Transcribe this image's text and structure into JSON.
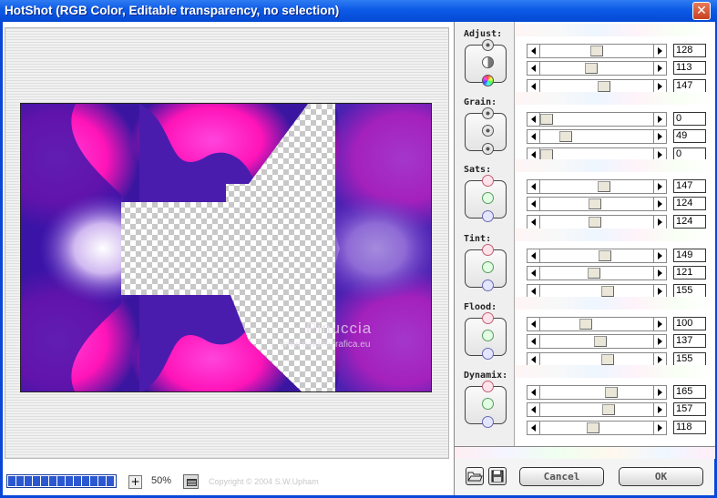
{
  "window": {
    "title": "HotShot (RGB Color, Editable transparency, no selection)",
    "close_icon": "close-icon"
  },
  "preview": {
    "watermark_name": "Pinuccia",
    "watermark_url": "www.madiregrafica.eu"
  },
  "footer": {
    "progress_fraction": 1.0,
    "zoom_plus": "+",
    "zoom": "50%",
    "copyright": "Copyright © 2004 S.W.Upham"
  },
  "groups": [
    {
      "label": "Adjust:",
      "knobs": [
        "gear-icon",
        "half-circle-icon",
        "color-wheel-icon"
      ],
      "values": [
        128,
        113,
        147
      ]
    },
    {
      "label": "Grain:",
      "knobs": [
        "grain-icon",
        "grain-icon",
        "grain-icon"
      ],
      "values": [
        0,
        49,
        0
      ]
    },
    {
      "label": "Sats:",
      "knobs": [
        "red-knob-icon",
        "green-knob-icon",
        "blue-knob-icon"
      ],
      "values": [
        147,
        124,
        124
      ]
    },
    {
      "label": "Tint:",
      "knobs": [
        "red-knob-icon",
        "green-knob-icon",
        "blue-knob-icon"
      ],
      "values": [
        149,
        121,
        155
      ]
    },
    {
      "label": "Flood:",
      "knobs": [
        "red-knob-icon",
        "green-knob-icon",
        "blue-knob-icon"
      ],
      "values": [
        100,
        137,
        155
      ]
    },
    {
      "label": "Dynamix:",
      "knobs": [
        "red-knob-icon",
        "green-knob-icon",
        "blue-knob-icon"
      ],
      "values": [
        165,
        157,
        118
      ]
    }
  ],
  "slider_max": 255,
  "buttons": {
    "open_icon": "folder-open-icon",
    "save_icon": "floppy-save-icon",
    "cancel": "Cancel",
    "ok": "OK"
  },
  "colors": {
    "title_bar": "#0a46d8",
    "accent_magenta": "#ff22c8",
    "accent_violet": "#3a16a0"
  }
}
